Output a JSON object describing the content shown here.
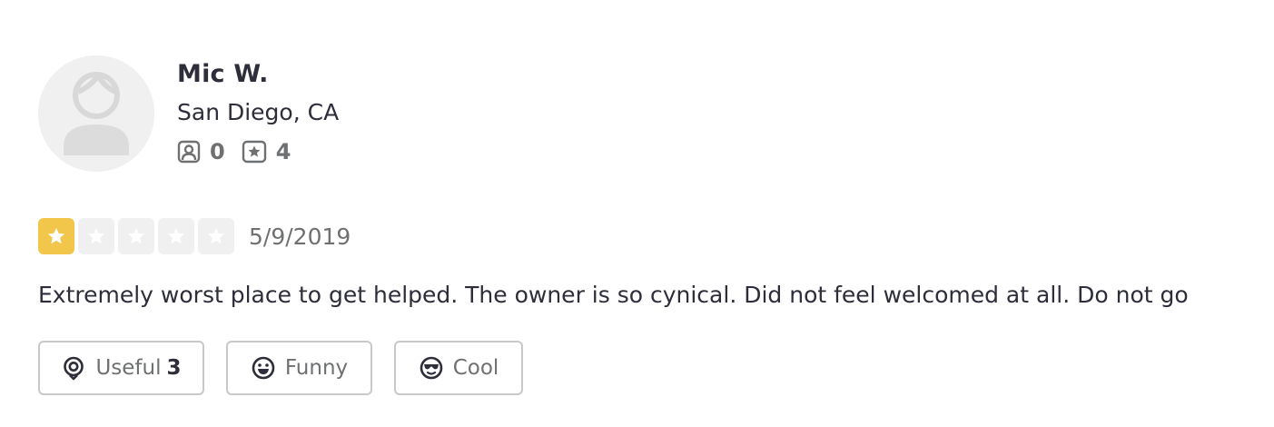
{
  "reviewer": {
    "name": "Mic W.",
    "location": "San Diego, CA",
    "friends_count": "0",
    "reviews_count": "4",
    "avatar_icon": "default-user-avatar-icon"
  },
  "review": {
    "rating": 1,
    "max_rating": 5,
    "date": "5/9/2019",
    "text": "Extremely worst place to get helped. The owner is so cynical. Did not feel welcomed at all. Do not go"
  },
  "actions": {
    "useful_label": "Useful",
    "useful_count": "3",
    "funny_label": "Funny",
    "cool_label": "Cool"
  },
  "colors": {
    "star_filled": "#f2c64b",
    "star_empty": "#f0f0f0",
    "text_primary": "#2d2e3a",
    "text_secondary": "#6e7072",
    "button_border": "#c8c9ca"
  }
}
